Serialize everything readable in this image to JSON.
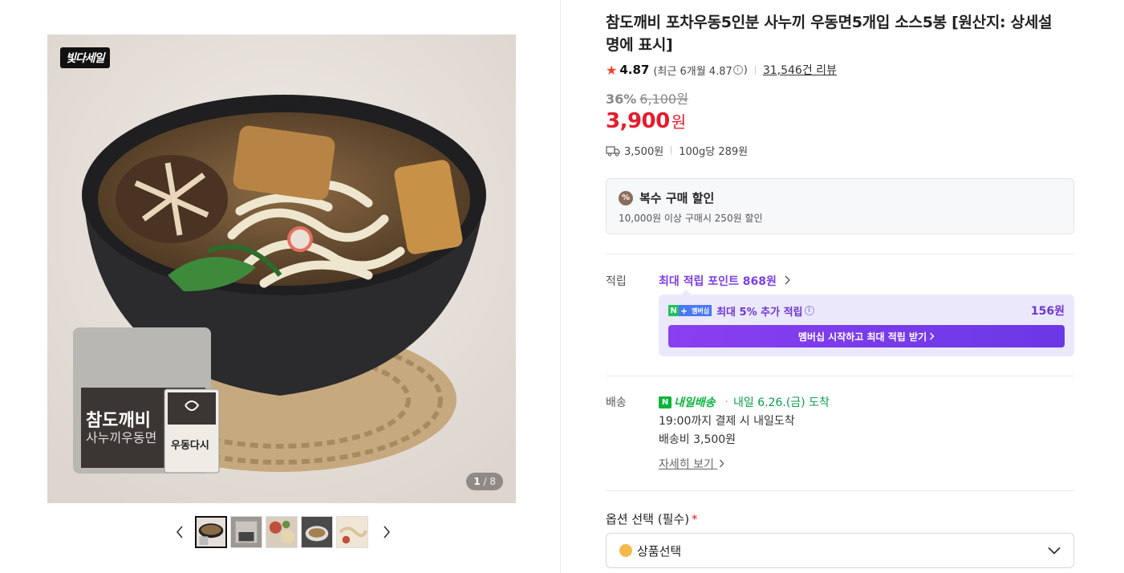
{
  "gallery": {
    "badge": "빛다세일",
    "counter_current": "1",
    "counter_total": "/ 8",
    "package_text_main": "참도깨비",
    "package_text_sub": "사누끼우동면",
    "sauce_text": "우동다시",
    "thumbnails": [
      "thumb-1",
      "thumb-2",
      "thumb-3",
      "thumb-4",
      "thumb-5"
    ]
  },
  "product": {
    "title": "참도깨비 포차우동5인분 사누끼 우동면5개입 소스5봉 [원산지: 상세설명에 표시]",
    "rating": "4.87",
    "rating_recent": "(최근 6개월 4.87",
    "rating_recent_close": ")",
    "review_count": "31,546건 리뷰",
    "discount_rate": "36%",
    "original_price": "6,100원",
    "price": "3,900",
    "price_unit": "원",
    "shipping_fee": "3,500원",
    "unit_price": "100g당 289원"
  },
  "multi_discount": {
    "title": "복수 구매 할인",
    "description": "10,000원 이상 구매시 250원 할인"
  },
  "points": {
    "label": "적립",
    "max_points": "최대 적립 포인트 868원",
    "badge_label": "멤버십",
    "extra_text": "최대 5% 추가 적립",
    "extra_amount": "156원",
    "button_label": "멤버십 시작하고 최대 적립 받기"
  },
  "delivery": {
    "label": "배송",
    "service_name": "내일배송",
    "arrival": "내일 6.26.(금) 도착",
    "cutoff": "19:00까지 결제 시 내일도착",
    "fee": "배송비 3,500원",
    "detail_link": "자세히 보기"
  },
  "options": {
    "label": "옵션 선택 (필수)",
    "required_mark": "*",
    "select_value": "상품선택"
  },
  "colors": {
    "price_red": "#e41c2e",
    "point_purple": "#7b3fe4",
    "delivery_green": "#07b53b"
  }
}
